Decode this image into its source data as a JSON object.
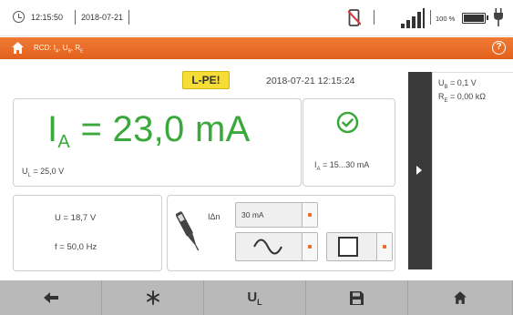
{
  "status_bar": {
    "time": "12:15:50",
    "date": "2018-07-21",
    "battery_percent": "100 %",
    "battery_level": 1.0
  },
  "header": {
    "title": "RCD: I",
    "title_sub_a": "A",
    "title_mid": ", U",
    "title_sub_b": "B",
    "title_end": ", R",
    "title_sub_e": "E",
    "help_label": "?"
  },
  "measurement": {
    "warning_badge": "L-PE!",
    "datetime": "2018-07-21 12:15:24",
    "main_symbol": "I",
    "main_symbol_sub": "A",
    "main_value": " = 23,0 mA",
    "ul_label": "U",
    "ul_sub": "L",
    "ul_value": " = 25,0 V",
    "ia_range_label": "I",
    "ia_range_sub": "A",
    "ia_range_value": " = 15...30 mA",
    "u_value": "U = 18,7 V",
    "f_value": "f = 50,0 Hz"
  },
  "settings": {
    "idn_label": "IΔn",
    "idn_value": "30 mA",
    "waveform": "~"
  },
  "side_panel": {
    "ub_label": "U",
    "ub_sub": "B",
    "ub_value": " = 0,1 V",
    "re_label": "R",
    "re_sub": "E",
    "re_value": " = 0,00 kΩ"
  },
  "toolbar": {
    "ul_label": "U",
    "ul_sub": "L"
  },
  "colors": {
    "accent_orange": "#e8692a",
    "result_green": "#3aa83a",
    "warning_yellow": "#f5dd35",
    "toolbar_gray": "#b9b9b9",
    "side_tab_dark": "#3a3a3a"
  },
  "icons": [
    "clock-icon",
    "phone-off-icon",
    "signal-icon",
    "battery-icon",
    "plug-icon",
    "home-icon",
    "help-icon",
    "check-circle-icon",
    "probe-icon",
    "sine-wave-icon",
    "square-wave-icon",
    "arrow-left-icon",
    "asterisk-icon",
    "save-icon",
    "home-icon"
  ]
}
